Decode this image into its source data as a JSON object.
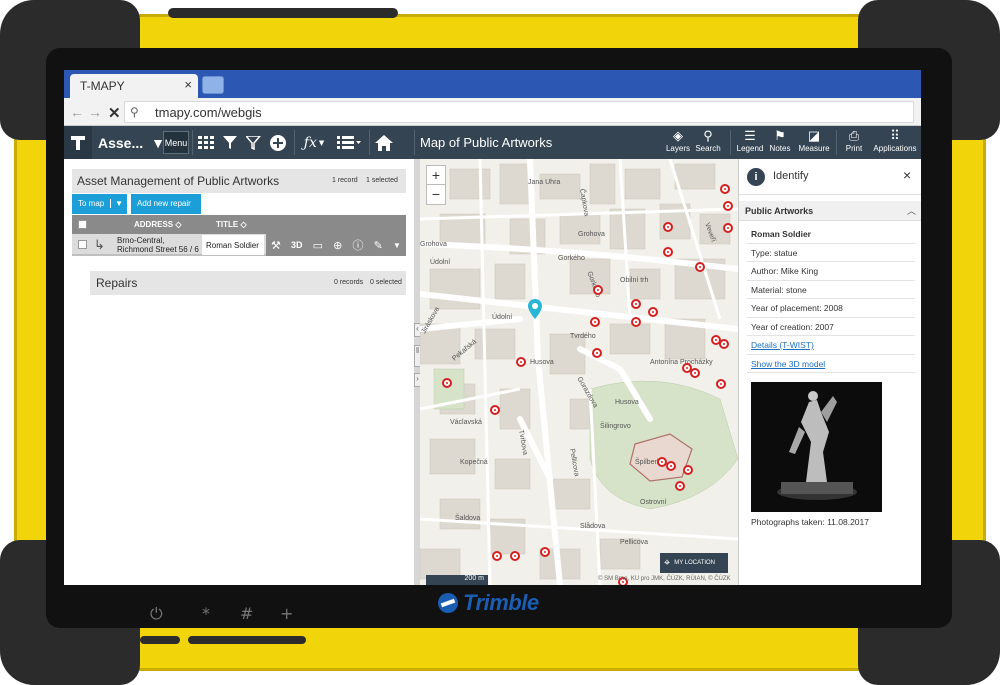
{
  "browser": {
    "tab_title": "T-MAPY",
    "tab_close": "×",
    "url": "tmapy.com/webgis"
  },
  "toolbar": {
    "assets_label": "Asse...",
    "assets_caret": "▼",
    "menu_label": "Menu",
    "map_title": "Map of Public Artworks",
    "tools": [
      {
        "label": "Layers",
        "icon": "layers-icon",
        "glyph": "◈"
      },
      {
        "label": "Search",
        "icon": "search-icon",
        "glyph": "⚲"
      },
      {
        "label": "Legend",
        "icon": "legend-icon",
        "glyph": "☰"
      },
      {
        "label": "Notes",
        "icon": "notes-icon",
        "glyph": "⚑"
      },
      {
        "label": "Measure",
        "icon": "measure-icon",
        "glyph": "◪"
      },
      {
        "label": "Print",
        "icon": "print-icon",
        "glyph": "⎙"
      },
      {
        "label": "Applications",
        "icon": "applications-icon",
        "glyph": "⠿"
      }
    ]
  },
  "left_panel": {
    "title": "Asset Management of Public Artworks",
    "record_count": "1 record",
    "selected_count": "1 selected",
    "to_map_label": "To map",
    "add_repair_label": "Add new repair",
    "columns": [
      "ADDRESS",
      "TITLE"
    ],
    "rows": [
      {
        "address_line1": "Brno-Central,",
        "address_line2": "Richmond Street 56 / 6",
        "title": "Roman Soldier"
      }
    ],
    "row_icon_3d": "3D",
    "repairs": {
      "title": "Repairs",
      "records": "0 records",
      "selected": "0 selected"
    }
  },
  "map": {
    "zoom_in": "+",
    "zoom_out": "−",
    "my_location_label": "MY LOCATION",
    "scale_label": "200 m",
    "attribution": "© SM Brno, KU pro JMK, ČÚZK, RÚIAN, © ČÚZK",
    "street_labels": [
      "Jana Uhra",
      "Grohova",
      "Gorkého",
      "Údolní",
      "Obilní trh",
      "Jiráskova",
      "Pekařská",
      "Husova",
      "Tvrdého",
      "Gorkého",
      "Údolní",
      "Veveří",
      "Grohova",
      "Husova",
      "Špilberk",
      "Gorazdova",
      "Pellicova",
      "Tvrbova",
      "Šaldova",
      "Slådova",
      "Pellicova",
      "Šilingrovo",
      "Václavská",
      "Kopečná",
      "Ostrovní",
      "Čapkova",
      "Antonína Procházky"
    ]
  },
  "identify": {
    "title": "Identify",
    "close": "×",
    "section_title": "Public Artworks",
    "rows": [
      {
        "text": "Roman Soldier",
        "style": "bold"
      },
      {
        "text": "Type: statue",
        "style": "plain"
      },
      {
        "text": "Author: Mike King",
        "style": "plain"
      },
      {
        "text": "Material: stone",
        "style": "plain"
      },
      {
        "text": "Year of placement: 2008",
        "style": "plain"
      },
      {
        "text": "Year of creation: 2007",
        "style": "plain"
      },
      {
        "text": "Details (T-WIST)",
        "style": "link"
      },
      {
        "text": "Show the 3D model",
        "style": "link"
      }
    ],
    "photo_caption": "Photographs taken: 11.08.2017"
  },
  "device": {
    "brand": "Trimble",
    "keys": [
      "⏻",
      "*",
      "#",
      "+"
    ]
  },
  "colors": {
    "toolbar": "#344453",
    "accent_button": "#1c9fd8",
    "housing": "#f2d40a",
    "brand": "#1a5db2",
    "marker": "#d42020"
  }
}
